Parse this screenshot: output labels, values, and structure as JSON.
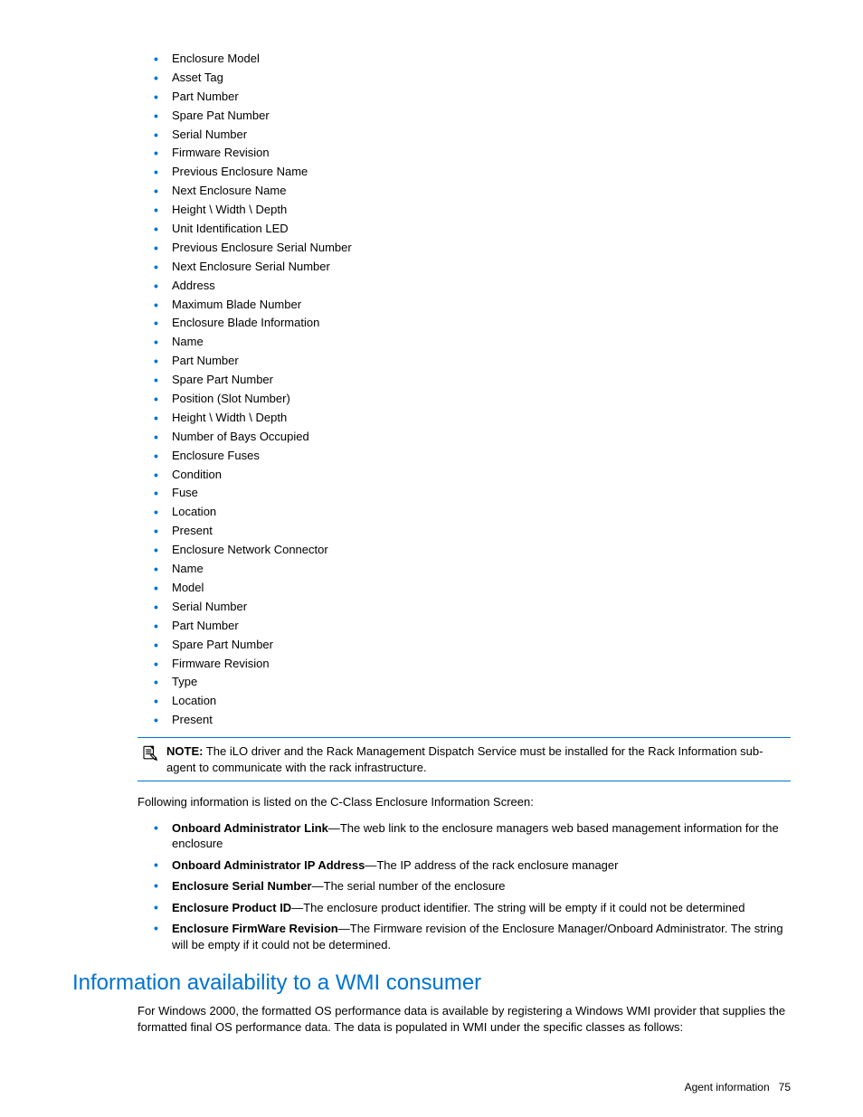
{
  "list1": [
    "Enclosure Model",
    "Asset Tag",
    "Part Number",
    "Spare Pat Number",
    "Serial Number",
    "Firmware Revision",
    "Previous Enclosure Name",
    "Next Enclosure Name",
    "Height \\ Width \\ Depth",
    "Unit Identification LED",
    "Previous Enclosure Serial Number",
    "Next Enclosure Serial Number",
    "Address",
    "Maximum Blade Number",
    "Enclosure Blade Information",
    "Name",
    "Part Number",
    "Spare Part Number",
    "Position (Slot Number)",
    "Height \\ Width \\ Depth",
    "Number of Bays Occupied",
    "Enclosure Fuses",
    "Condition",
    "Fuse",
    "Location",
    "Present",
    "Enclosure Network Connector",
    "Name",
    "Model",
    "Serial Number",
    "Part Number",
    "Spare Part Number",
    "Firmware Revision",
    "Type",
    "Location",
    "Present"
  ],
  "note": {
    "label": "NOTE:",
    "text": "The iLO driver and the Rack Management Dispatch Service must be installed for the Rack Information sub-agent to communicate with the rack infrastructure."
  },
  "lead": "Following information is listed on the C-Class Enclosure Information Screen:",
  "defs": [
    {
      "term": "Onboard Administrator Link",
      "desc": "—The web link to the enclosure managers web based management information for the enclosure"
    },
    {
      "term": "Onboard Administrator IP Address",
      "desc": "—The IP address of the rack enclosure manager"
    },
    {
      "term": "Enclosure Serial Number",
      "desc": "—The serial number of the enclosure"
    },
    {
      "term": "Enclosure Product ID",
      "desc": "—The enclosure product identifier. The string will be empty if it could not be determined"
    },
    {
      "term": "Enclosure FirmWare Revision",
      "desc": "—The Firmware revision of the Enclosure Manager/Onboard Administrator. The string will be empty if it could not be determined."
    }
  ],
  "heading": "Information availability to a WMI consumer",
  "body": "For Windows 2000, the formatted OS performance data is available by registering a Windows WMI provider that supplies the formatted final OS performance data. The data is populated in WMI under the specific classes as follows:",
  "footer": {
    "section": "Agent information",
    "page": "75"
  }
}
